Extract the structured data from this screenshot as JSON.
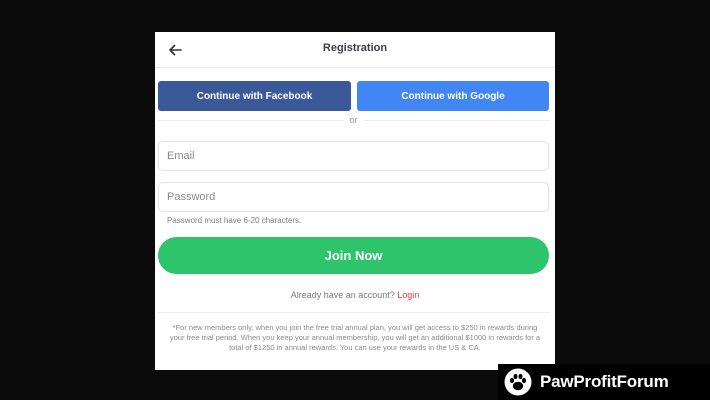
{
  "header": {
    "title": "Registration"
  },
  "social": {
    "facebook_label": "Continue with Facebook",
    "google_label": "Continue with Google"
  },
  "separator": "or",
  "form": {
    "email_placeholder": "Email",
    "password_placeholder": "Password",
    "password_hint": "Password must have 6-20 characters.",
    "submit_label": "Join Now"
  },
  "login_prompt": {
    "text": "Already have an account?",
    "link": "Login"
  },
  "disclaimer": "*For new members only, when you join the free trial annual plan, you will get access to $250 in rewards during your free trial period. When you keep your annual membership, you will get an additional $1000 in rewards for a total of $1250 in annual rewards. You can use your rewards in the US & CA.",
  "watermark": {
    "text": "PawProfitForum",
    "icon": "paw-icon"
  },
  "colors": {
    "facebook": "#3b5998",
    "google": "#4286f4",
    "join": "#2ec46c",
    "login_link": "#e5413b"
  }
}
